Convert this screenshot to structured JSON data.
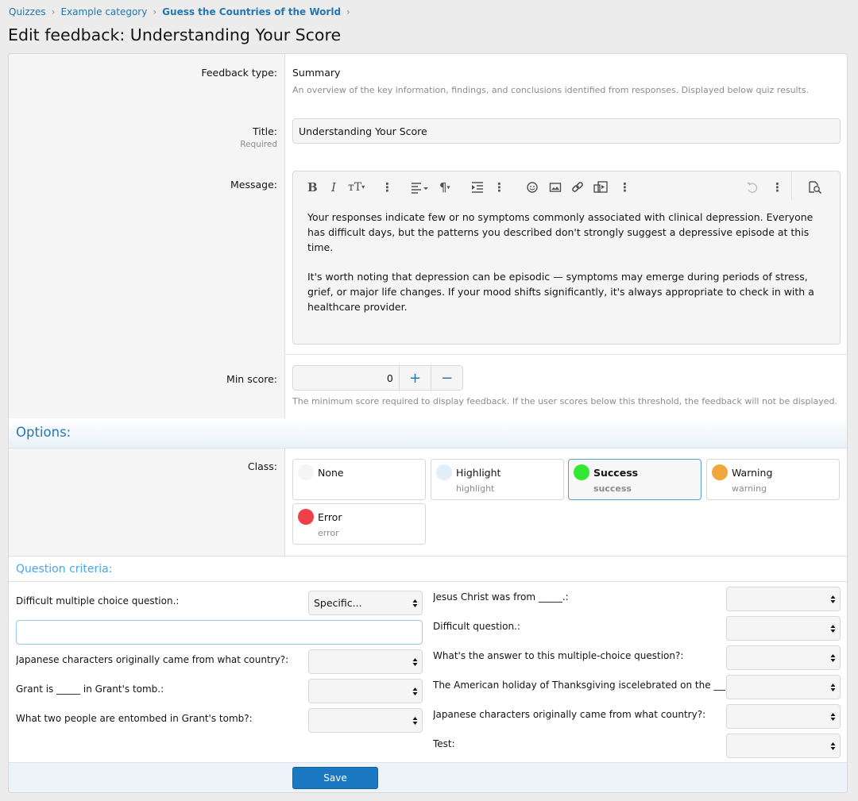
{
  "breadcrumb": [
    "Quizzes",
    "Example category",
    "Guess the Countries of the World"
  ],
  "page_title": "Edit feedback: Understanding Your Score",
  "feedback_type": {
    "label": "Feedback type:",
    "value": "Summary",
    "description": "An overview of the key information, findings, and conclusions identified from responses. Displayed below quiz results."
  },
  "title_field": {
    "label": "Title:",
    "hint": "Required",
    "value": "Understanding Your Score"
  },
  "message": {
    "label": "Message:",
    "paragraphs": [
      "Your responses indicate few or no symptoms commonly associated with clinical depression. Everyone has difficult days, but the patterns you described don't strongly suggest a depressive episode at this time.",
      "It's worth noting that depression can be episodic — symptoms may emerge during periods of stress, grief, or major life changes. If your mood shifts significantly, it's always appropriate to check in with a healthcare provider."
    ],
    "toolbar_icons": [
      "bold-icon",
      "italic-icon",
      "text-size-icon",
      "more-icon",
      "align-icon",
      "paragraph-icon",
      "indent-icon",
      "more-icon",
      "smiley-icon",
      "image-icon",
      "link-icon",
      "media-icon",
      "more-icon",
      "undo-icon",
      "more-icon",
      "preview-icon"
    ]
  },
  "min_score": {
    "label": "Min score:",
    "value": "0",
    "plus": "+",
    "minus": "−",
    "description": "The minimum score required to display feedback. If the user scores below this threshold, the feedback will not be displayed."
  },
  "options": {
    "heading": "Options:",
    "class_label": "Class:",
    "classes": [
      {
        "name": "None",
        "sub": "",
        "color": "#f5f5f5",
        "selected": false
      },
      {
        "name": "Highlight",
        "sub": "highlight",
        "color": "#e3eef9",
        "selected": false
      },
      {
        "name": "Success",
        "sub": "success",
        "color": "#33e833",
        "selected": true
      },
      {
        "name": "Warning",
        "sub": "warning",
        "color": "#f0a83c",
        "selected": false
      },
      {
        "name": "Error",
        "sub": "error",
        "color": "#ef3f47",
        "selected": false
      }
    ]
  },
  "criteria": {
    "heading": "Question criteria:",
    "left": [
      {
        "label": "Difficult multiple choice question.:",
        "value": "Specific..."
      },
      {
        "label": "Japanese characters originally came from what country?:",
        "value": ""
      },
      {
        "label": "Grant is _____ in Grant's tomb.:",
        "value": ""
      },
      {
        "label": "What two people are entombed in Grant's tomb?:",
        "value": ""
      }
    ],
    "right": [
      {
        "label": "Jesus Christ was from _____.:",
        "value": ""
      },
      {
        "label": "Difficult question.:",
        "value": ""
      },
      {
        "label": "What's the answer to this multiple-choice question?:",
        "value": ""
      },
      {
        "label": "The American holiday of Thanksgiving iscelebrated on the _____:",
        "value": ""
      },
      {
        "label": "Japanese characters originally came from what country?:",
        "value": ""
      },
      {
        "label": "Test:",
        "value": ""
      }
    ]
  },
  "save_label": "Save",
  "colors": {
    "accent": "#2577b1",
    "button": "#1b78c2"
  }
}
